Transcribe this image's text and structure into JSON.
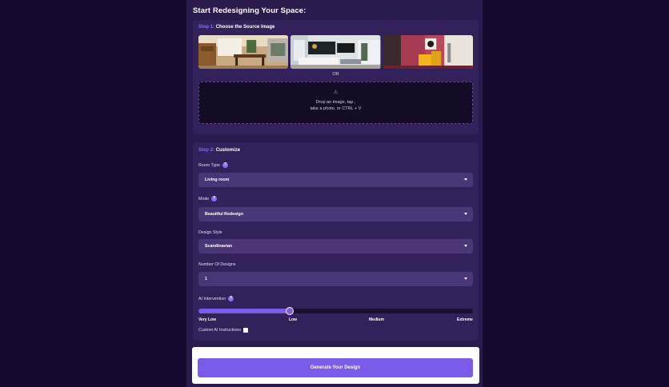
{
  "page": {
    "title": "Start Redesigning Your Space:"
  },
  "step1": {
    "step_label": "Step 1:",
    "title": "Choose the Source Image",
    "images": [
      "kitchen-dining-room",
      "modern-living-room",
      "pink-room-yellow-chair"
    ],
    "or_text": "OR",
    "dropzone": {
      "icon": "upload-icon",
      "icon_glyph": "⚠",
      "line1": "Drop an image, tap ,",
      "line2": "take a photo, or CTRL + V"
    }
  },
  "step2": {
    "step_label": "Step 2:",
    "title": "Customize",
    "room_type": {
      "label": "Room Type",
      "value": "Living room"
    },
    "mode": {
      "label": "Mode",
      "value": "Beautiful Redesign"
    },
    "design_style": {
      "label": "Design Style",
      "value": "Scandinavian"
    },
    "number_of_designs": {
      "label": "Number Of Designs",
      "value": "1"
    },
    "ai_intervention": {
      "label": "AI Intervention",
      "ticks": [
        "Very Low",
        "Low",
        "Medium",
        "Extreme"
      ],
      "value": "Low",
      "level_fraction": 0.333
    },
    "custom_instructions": {
      "label": "Custom AI Instructions",
      "checked": false
    }
  },
  "generate": {
    "label": "Generate Your Design"
  },
  "colors": {
    "background": "#150a2e",
    "panel": "#2a1a4d",
    "card": "#32215a",
    "accent": "#7a5ce8",
    "select": "#4a3677"
  },
  "help_glyph": "?"
}
